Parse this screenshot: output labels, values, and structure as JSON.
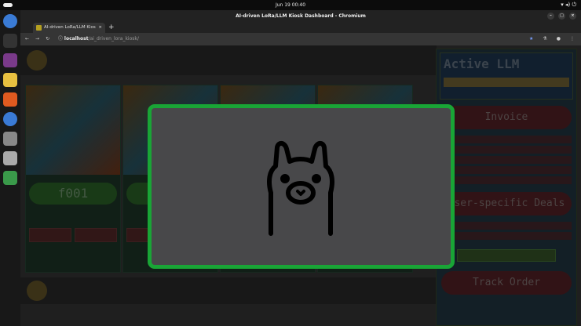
{
  "system": {
    "clock": "Jun 19  00:40"
  },
  "window": {
    "title": "AI-driven LoRa/LLM Kiosk Dashboard - Chromium"
  },
  "browser": {
    "tab_label": "AI-driven LoRa/LLM Kios",
    "url_host": "localhost",
    "url_path": "/ai_driven_lora_kiosk/"
  },
  "page": {
    "cards": [
      {
        "code": "f001"
      },
      {
        "code": ""
      }
    ],
    "side": {
      "active_llm_title": "Active LLM",
      "invoice_title": "Invoice",
      "deals_title": "User-specific Deals",
      "track_order": "Track Order"
    }
  },
  "modal": {
    "icon": "ollama-llama-icon"
  },
  "colors": {
    "modal_border": "#19a536",
    "modal_bg": "#48484a"
  }
}
